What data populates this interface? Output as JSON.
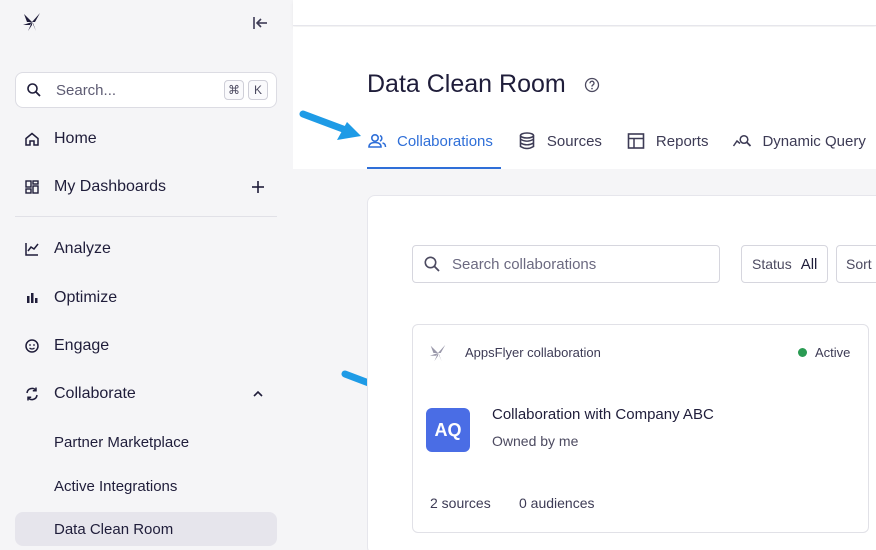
{
  "sidebar": {
    "search": {
      "placeholder": "Search...",
      "shortcut_cmd": "⌘",
      "shortcut_key": "K"
    },
    "items": [
      {
        "label": "Home",
        "icon": "home-icon"
      },
      {
        "label": "My Dashboards",
        "icon": "dashboards-icon",
        "action": "+"
      },
      {
        "label": "Analyze",
        "icon": "analyze-icon"
      },
      {
        "label": "Optimize",
        "icon": "bar-chart-icon"
      },
      {
        "label": "Engage",
        "icon": "engage-icon"
      },
      {
        "label": "Collaborate",
        "icon": "sync-icon",
        "expanded": true
      }
    ],
    "sub_items": [
      {
        "label": "Partner Marketplace"
      },
      {
        "label": "Active Integrations"
      },
      {
        "label": "Data Clean Room",
        "active": true
      }
    ]
  },
  "main": {
    "title": "Data Clean Room",
    "tabs": [
      {
        "label": "Collaborations",
        "icon": "users-icon",
        "active": true
      },
      {
        "label": "Sources",
        "icon": "database-icon"
      },
      {
        "label": "Reports",
        "icon": "table-icon"
      },
      {
        "label": "Dynamic Query",
        "icon": "query-icon"
      }
    ],
    "search_placeholder": "Search collaborations",
    "status_filter": {
      "label": "Status",
      "value": "All"
    },
    "sort_label": "Sort",
    "card": {
      "provider": "AppsFlyer collaboration",
      "status": "Active",
      "avatar": "AQ",
      "title": "Collaboration with Company ABC",
      "owner": "Owned by me",
      "sources": "2 sources",
      "audiences": "0 audiences"
    }
  },
  "colors": {
    "accent": "#2f6fd8",
    "arrow": "#1e9be6",
    "avatar_bg": "#4a6de5",
    "status_active": "#2a9b53",
    "sidebar_bg": "#f5f5f7"
  }
}
